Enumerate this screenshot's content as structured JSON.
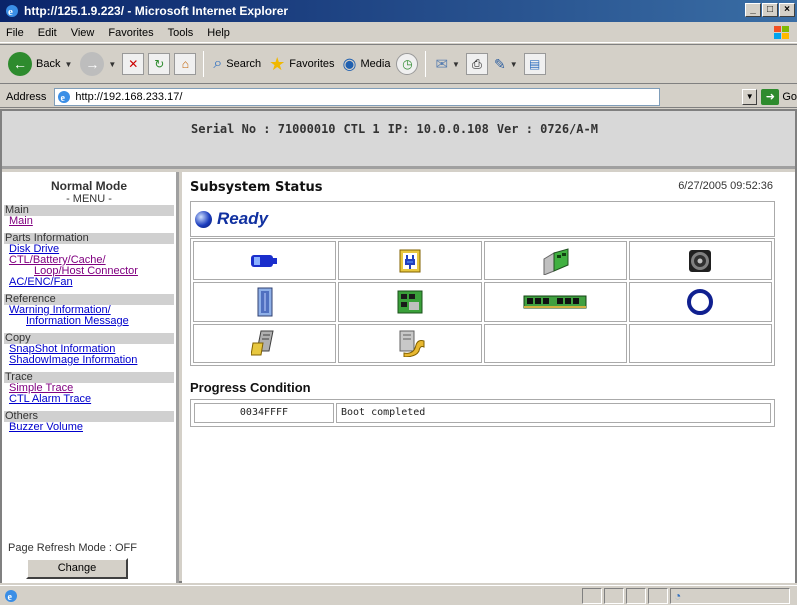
{
  "window": {
    "title": "http://125.1.9.223/ - Microsoft Internet Explorer"
  },
  "menubar": {
    "items": [
      "File",
      "Edit",
      "View",
      "Favorites",
      "Tools",
      "Help"
    ]
  },
  "toolbar": {
    "back_label": "Back",
    "search_label": "Search",
    "favorites_label": "Favorites",
    "media_label": "Media"
  },
  "addressbar": {
    "label": "Address",
    "url": "http://192.168.233.17/",
    "go_label": "Go"
  },
  "header": {
    "serial": "Serial No : 71000010",
    "ctl": "CTL 1",
    "ip": "IP: 10.0.0.108",
    "ver": "Ver : 0726/A-M"
  },
  "menu": {
    "mode_title": "Normal Mode",
    "mode_sub": "- MENU -",
    "sections": {
      "main": "Main",
      "parts": "Parts Information",
      "reference": "Reference",
      "copy": "Copy",
      "trace": "Trace",
      "others": "Others"
    },
    "links": {
      "main": "Main",
      "disk_drive": "Disk Drive",
      "ctl_line1": "CTL/Battery/Cache/",
      "ctl_line2": "Loop/Host Connector",
      "ac_enc_fan": "AC/ENC/Fan",
      "warning_line1": "Warning Information/",
      "warning_line2": "Information Message",
      "snapshot": "SnapShot Information",
      "shadowimage": "ShadowImage Information",
      "simple_trace": "Simple Trace",
      "ctl_alarm": "CTL Alarm Trace",
      "buzzer": "Buzzer Volume"
    },
    "refresh_label": "Page Refresh Mode : OFF",
    "change_label": "Change"
  },
  "status": {
    "title": "Subsystem Status",
    "datetime": "6/27/2005 09:52:36",
    "state": "Ready"
  },
  "components": [
    "battery-icon",
    "power-supply-icon",
    "controller-board-icon",
    "fan-icon",
    "disk-drive-icon",
    "cache-memory-board-icon",
    "memory-module-icon",
    "loop-icon",
    "host-connector-icon",
    "enclosure-icon",
    "",
    ""
  ],
  "progress": {
    "title": "Progress Condition",
    "code": "0034FFFF",
    "message": "Boot completed"
  },
  "colors": {
    "titlebar": "#0a246a",
    "link": "#0000cc",
    "visited": "#800080",
    "ready": "#1030a0"
  }
}
